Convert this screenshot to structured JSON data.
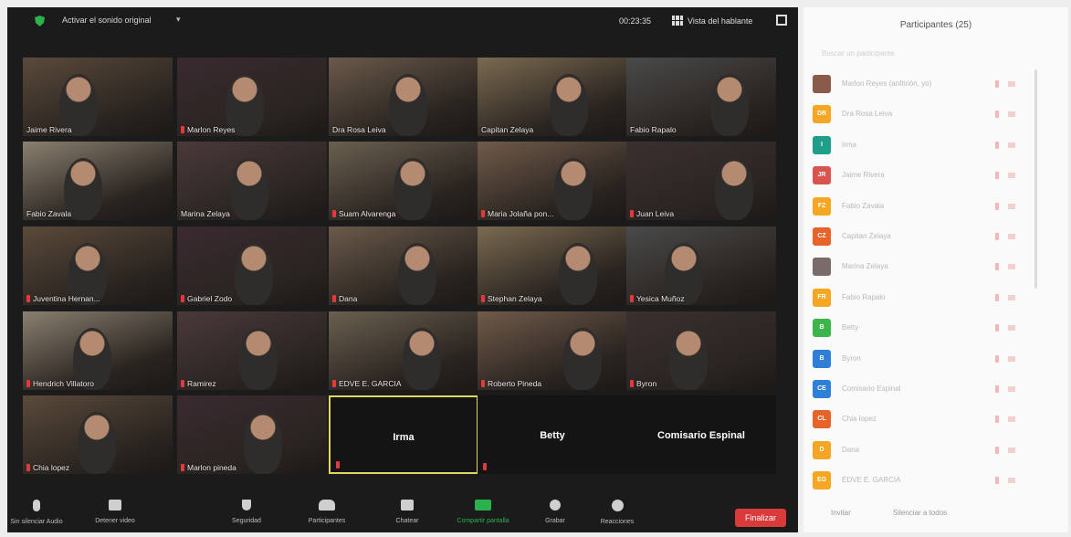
{
  "top_bar": {
    "original_sound_label": "Activar el sonido original",
    "elapsed_time": "00:23:35",
    "view_label": "Vista del hablante"
  },
  "tiles": [
    {
      "name": "Jaime Rivera",
      "muted": false
    },
    {
      "name": "Marlon Reyes",
      "muted": true
    },
    {
      "name": "Dra Rosa Leiva",
      "muted": false
    },
    {
      "name": "Capitan Zelaya",
      "muted": false
    },
    {
      "name": "Fabio Rapalo",
      "muted": false
    },
    {
      "name": "Fabio Zavala",
      "muted": false
    },
    {
      "name": "Marina Zelaya",
      "muted": false
    },
    {
      "name": "Suam Alvarenga",
      "muted": true
    },
    {
      "name": "Maria Jolaña pon...",
      "muted": true
    },
    {
      "name": "Juan Leiva",
      "muted": true
    },
    {
      "name": "Juventina Hernan...",
      "muted": true
    },
    {
      "name": "Gabriel Zodo",
      "muted": true
    },
    {
      "name": "Dana",
      "muted": true
    },
    {
      "name": "Stephan Zelaya",
      "muted": true
    },
    {
      "name": "Yesica Muñoz",
      "muted": true
    },
    {
      "name": "Hendrich Villatoro",
      "muted": true
    },
    {
      "name": "Ramirez",
      "muted": true
    },
    {
      "name": "EDVE E. GARCIA",
      "muted": true
    },
    {
      "name": "Roberto Pineda",
      "muted": true
    },
    {
      "name": "Byron",
      "muted": true
    },
    {
      "name": "Chia lopez",
      "muted": true
    },
    {
      "name": "Marlon pineda",
      "muted": true
    },
    {
      "name": "Irma",
      "muted": false,
      "no_video": true,
      "active": true
    },
    {
      "name": "Betty",
      "muted": false,
      "no_video": true
    },
    {
      "name": "Comisario Espinal",
      "muted": false,
      "no_video": true
    }
  ],
  "toolbar": {
    "audio": "Sin silenciar Audio",
    "video": "Detener video",
    "security": "Seguridad",
    "participants": "Participantes",
    "chat": "Chatear",
    "share": "Compartir pantalla",
    "record": "Grabar",
    "reactions": "Reacciones",
    "end": "Finalizar"
  },
  "panel": {
    "title": "Participantes (25)",
    "search_hint": "Buscar un participante",
    "participants": [
      {
        "initials": "",
        "name": "Marlon Reyes (anfitrión, yo)",
        "color": "#8a5a4a"
      },
      {
        "initials": "DR",
        "name": "Dra Rosa Leiva",
        "color": "#f5a623"
      },
      {
        "initials": "I",
        "name": "Irma",
        "color": "#1f9e89"
      },
      {
        "initials": "JR",
        "name": "Jaime Rivera",
        "color": "#d9534f"
      },
      {
        "initials": "FZ",
        "name": "Fabio Zavala",
        "color": "#f5a623"
      },
      {
        "initials": "CZ",
        "name": "Capitan Zelaya",
        "color": "#e8632a"
      },
      {
        "initials": "",
        "name": "Marina Zelaya",
        "color": "#7a6a6a"
      },
      {
        "initials": "FR",
        "name": "Fabio Rapalo",
        "color": "#f5a623"
      },
      {
        "initials": "B",
        "name": "Betty",
        "color": "#3cb54a"
      },
      {
        "initials": "B",
        "name": "Byron",
        "color": "#2f7fd8"
      },
      {
        "initials": "CE",
        "name": "Comisario Espinal",
        "color": "#2f7fd8"
      },
      {
        "initials": "CL",
        "name": "Chia lopez",
        "color": "#e8632a"
      },
      {
        "initials": "D",
        "name": "Dana",
        "color": "#f5a623"
      },
      {
        "initials": "EG",
        "name": "EDVE E. GARCIA",
        "color": "#f5a623"
      }
    ],
    "invite": "Invitar",
    "mute_all": "Silenciar a todos"
  }
}
